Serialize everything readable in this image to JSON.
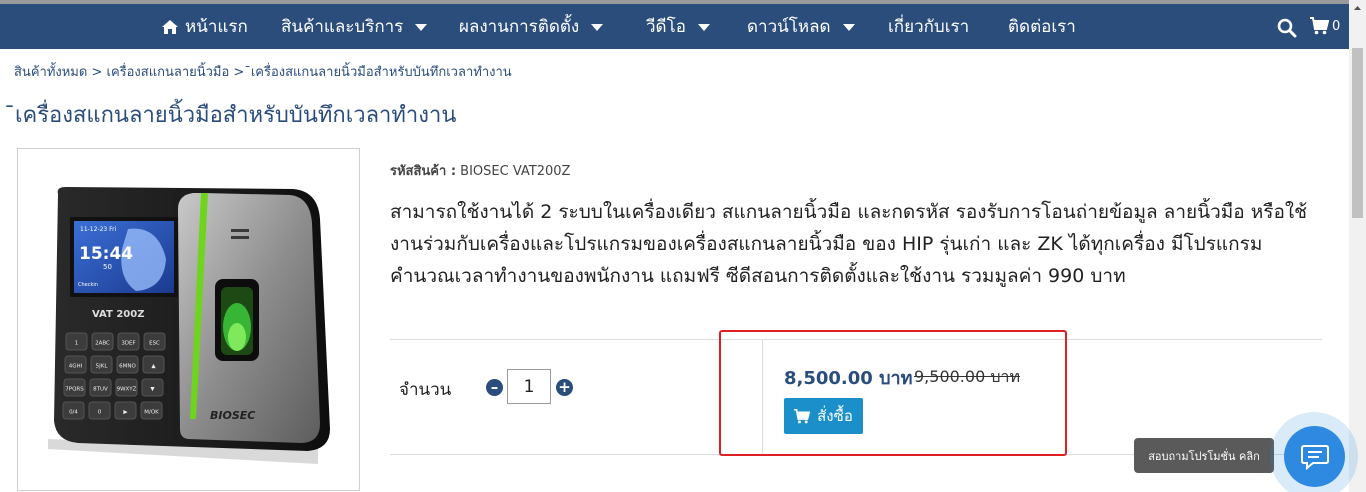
{
  "nav": {
    "home": "หน้าแรก",
    "products": "สินค้าและบริการ",
    "installations": "ผลงานการติดตั้ง",
    "video": "วีดีโอ",
    "download": "ดาวน์โหลด",
    "about": "เกี่ยวกับเรา",
    "contact": "ติดต่อเรา",
    "cart_count": "0"
  },
  "breadcrumb": {
    "item1": "สินค้าทั้งหมด",
    "sep1": " > ",
    "item2": "เครื่องสแกนลายนิ้วมือ",
    "sep2": " >",
    "item3": "¯เครื่องสแกนลายนิ้วมือสำหรับบันทึกเวลาทำงาน"
  },
  "product": {
    "title": "¯เครื่องสแกนลายนิ้วมือสำหรับบันทึกเวลาทำงาน",
    "sku_label": "รหัสสินค้า :",
    "sku_value": "BIOSEC VAT200Z",
    "description": "สามารถใช้งานได้ 2 ระบบในเครื่องเดียว สแกนลายนิ้วมือ และกดรหัส รองรับการโอนถ่ายข้อมูล ลายนิ้วมือ หรือใช้งานร่วมกับเครื่องและโปรแกรมของเครื่องสแกนลายนิ้วมือ ของ HIP รุ่นเก่า และ ZK ได้ทุกเครื่อง มีโปรแกรมคำนวณเวลาทำงานของพนักงาน แถมฟรี ซีดีสอนการติดตั้งและใช้งาน รวมมูลค่า 990 บาท",
    "quantity_label": "จำนวน",
    "quantity_value": "1",
    "price": "8,500.00 บาท",
    "old_price": "9,500.00 บาท",
    "buy_label": "สั่งซื้อ"
  },
  "device_image": {
    "screen_date": "11-12-23 Fri",
    "screen_time": "15:44",
    "screen_seconds": "50",
    "screen_status": "Checkin",
    "model_label": "VAT 200Z",
    "brand_label": "BIOSEC",
    "keys": [
      "1",
      "2ABC",
      "3DEF",
      "ESC",
      "4GHI",
      "5JKL",
      "6MNO",
      "▲",
      "7PQRS",
      "8TUV",
      "9WXYZ",
      "▼",
      "0/4",
      "0",
      "▶",
      "M/OK"
    ]
  },
  "chat": {
    "tooltip": "สอบถามโปรโมชั่น คลิก"
  },
  "colors": {
    "nav_bg": "#2a4d7c",
    "link": "#2a4d7c",
    "buy_button": "#1a8fc9",
    "highlight_border": "#e02020",
    "chat_button": "#2e8ae0"
  }
}
